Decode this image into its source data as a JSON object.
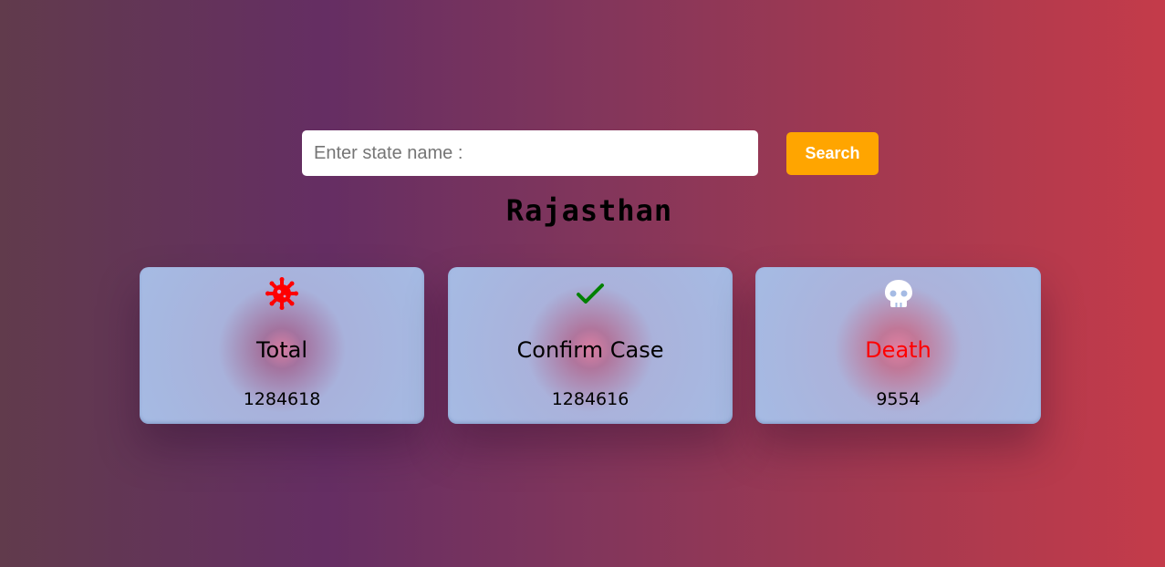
{
  "search": {
    "placeholder": "Enter state name :",
    "value": "",
    "button_label": "Search"
  },
  "state": {
    "name": "Rajasthan"
  },
  "cards": [
    {
      "icon": "virus-icon",
      "label": "Total",
      "value": "1284618",
      "icon_color": "#ff0000",
      "label_color": "#000000"
    },
    {
      "icon": "check-icon",
      "label": "Confirm Case",
      "value": "1284616",
      "icon_color": "#008000",
      "label_color": "#000000"
    },
    {
      "icon": "skull-icon",
      "label": "Death",
      "value": "9554",
      "icon_color": "#ffffff",
      "label_color": "#ff0000"
    }
  ],
  "colors": {
    "button": "#ffa500",
    "card_background": "#a5bbe4"
  }
}
